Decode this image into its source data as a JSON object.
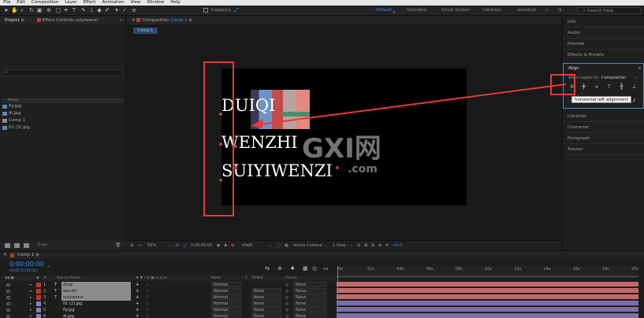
{
  "menu": [
    "File",
    "Edit",
    "Composition",
    "Layer",
    "Effect",
    "Animation",
    "View",
    "Window",
    "Help"
  ],
  "toolbar": {
    "snapping": "Snapping",
    "workspaces": [
      "Default",
      "Standard",
      "Small Screen",
      "Libraries",
      "standust"
    ],
    "active_workspace": "Default",
    "search_placeholder": "Search Help"
  },
  "project_panel": {
    "tab_project": "Project",
    "tab_effects": "Effect Controls suiyiwenzi",
    "header_name": "Name",
    "items": [
      "fly.jpg",
      "di.jpg",
      "Comp 1",
      "01 (2).jpg"
    ],
    "bottom_bpc": "8 bpc"
  },
  "viewer": {
    "tab": "Composition",
    "tab_comp": "Comp 1",
    "crumb": "Comp 1",
    "canvas_lines": [
      "DUIQI",
      "WENZHI",
      "SUIYIWENZI"
    ],
    "watermark": "GXI网",
    "watermark_sub": ".com",
    "zoom": "50%",
    "timecode": "0:00:00:00",
    "resolution": "(Half)",
    "camera": "Active Camera",
    "views": "1 View",
    "offset": "+0.0"
  },
  "right_panel": {
    "sections_top": [
      "Info",
      "Audio",
      "Preview",
      "Effects & Presets"
    ],
    "align_title": "Align",
    "align_to_label": "Align Layers to:",
    "align_to_value": "Composition",
    "tooltip": "horizontal left alignment",
    "sections_bottom": [
      "Libraries",
      "Character",
      "Paragraph",
      "Tracker"
    ]
  },
  "timeline": {
    "tab": "Comp 1",
    "timecode": "0:00:00:00",
    "fps": "00000 (25.00 fps)",
    "headers": {
      "source": "Source Name",
      "switches": "♣ ✱ \\ fx ▣ ◎ ◎ ◎",
      "mode": "Mode",
      "t": "T",
      "trkmat": "TrkMat",
      "parent": "Parent"
    },
    "layers": [
      {
        "num": "1",
        "type": "T",
        "name": "duiqi",
        "mode": "Normal",
        "trkmat": "",
        "parent": "None",
        "color": "#c0392b",
        "bar": "#c46a6a"
      },
      {
        "num": "2",
        "type": "T",
        "name": "wenzhi",
        "mode": "Normal",
        "trkmat": "None",
        "parent": "None",
        "color": "#c0392b",
        "bar": "#c46a6a"
      },
      {
        "num": "3",
        "type": "T",
        "name": "suiyiwenzi",
        "mode": "Normal",
        "trkmat": "None",
        "parent": "None",
        "color": "#c0392b",
        "bar": "#c46a6a"
      },
      {
        "num": "4",
        "type": "",
        "name": "01 (2).jpg",
        "mode": "Normal",
        "trkmat": "None",
        "parent": "None",
        "color": "#8e7cc3",
        "bar": "#7d6fa8"
      },
      {
        "num": "5",
        "type": "",
        "name": "fly.jpg",
        "mode": "Normal",
        "trkmat": "None",
        "parent": "None",
        "color": "#8e7cc3",
        "bar": "#7d6fa8"
      },
      {
        "num": "6",
        "type": "",
        "name": "di.jpg",
        "mode": "Normal",
        "trkmat": "None",
        "parent": "None",
        "color": "#8e7cc3",
        "bar": "#7d6fa8"
      }
    ],
    "ruler_ticks": [
      "0s",
      "02s",
      "04s",
      "06s",
      "08s",
      "10s",
      "12s",
      "14s",
      "16s",
      "18s",
      "20s"
    ]
  },
  "colors": {
    "accent": "#3d8ee6",
    "highlight_red": "#e63a3a"
  }
}
